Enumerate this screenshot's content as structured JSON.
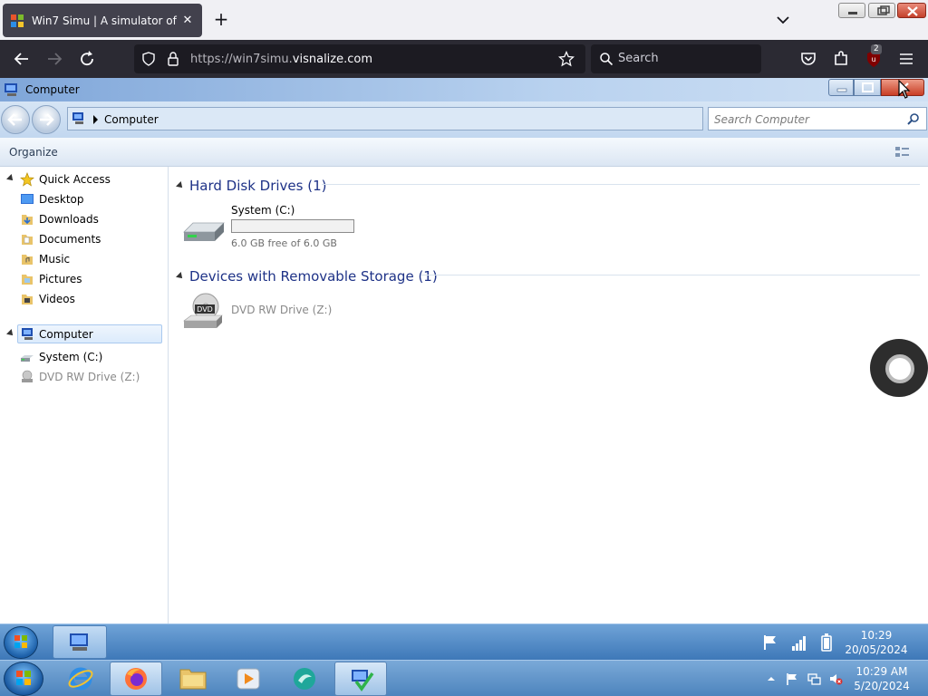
{
  "browser": {
    "tab_title": "Win7 Simu | A simulator of Win",
    "url_prefix": "https://win7simu.",
    "url_domain": "visnalize.com",
    "search_placeholder": "Search",
    "extension_badge": "2"
  },
  "window": {
    "title": "Computer",
    "address": "Computer",
    "search_placeholder": "Search Computer",
    "organize_label": "Organize"
  },
  "nav": {
    "quick_access": "Quick Access",
    "favorites": [
      {
        "label": "Desktop",
        "icon": "desktop-icon"
      },
      {
        "label": "Downloads",
        "icon": "downloads-folder-icon"
      },
      {
        "label": "Documents",
        "icon": "documents-folder-icon"
      },
      {
        "label": "Music",
        "icon": "music-folder-icon"
      },
      {
        "label": "Pictures",
        "icon": "pictures-folder-icon"
      },
      {
        "label": "Videos",
        "icon": "videos-folder-icon"
      }
    ],
    "computer": "Computer",
    "drives": [
      {
        "label": "System (C:)",
        "icon": "hard-drive-icon"
      },
      {
        "label": "DVD RW Drive (Z:)",
        "icon": "dvd-drive-icon"
      }
    ]
  },
  "content": {
    "hdd_group": "Hard Disk Drives (1)",
    "system_drive": "System (C:)",
    "system_used_fraction": 0.0,
    "system_free": "6.0 GB free of 6.0 GB",
    "removable_group": "Devices with Removable Storage (1)",
    "dvd_drive": "DVD RW Drive (Z:)"
  },
  "taskbar_sim": {
    "time": "10:29",
    "date": "20/05/2024"
  },
  "taskbar_host": {
    "time": "10:29 AM",
    "date": "5/20/2024"
  },
  "colors": {
    "accent": "#26a0da",
    "group_heading": "#1e3287",
    "browser_dark": "#2b2a33"
  }
}
